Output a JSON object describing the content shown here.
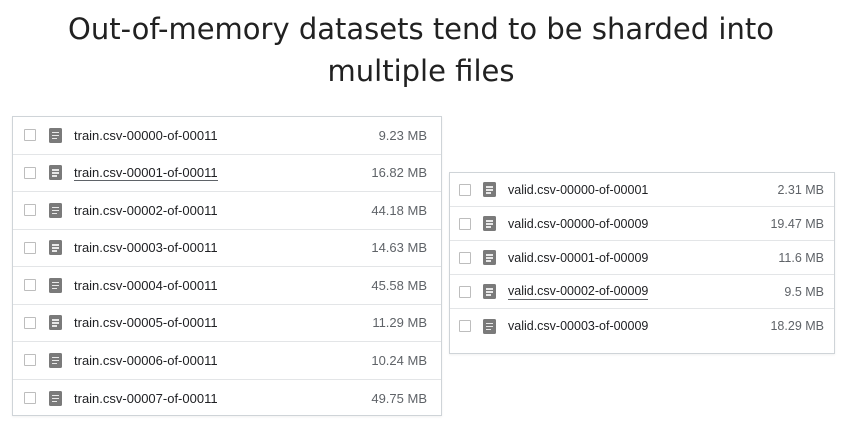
{
  "title": {
    "line1": "Out-of-memory datasets tend to be sharded into",
    "line2": "multiple files"
  },
  "train_files": [
    {
      "name": "train.csv-00000-of-00011",
      "size": "9.23 MB"
    },
    {
      "name": "train.csv-00001-of-00011",
      "size": "16.82 MB"
    },
    {
      "name": "train.csv-00002-of-00011",
      "size": "44.18 MB"
    },
    {
      "name": "train.csv-00003-of-00011",
      "size": "14.63 MB"
    },
    {
      "name": "train.csv-00004-of-00011",
      "size": "45.58 MB"
    },
    {
      "name": "train.csv-00005-of-00011",
      "size": "11.29 MB"
    },
    {
      "name": "train.csv-00006-of-00011",
      "size": "10.24 MB"
    },
    {
      "name": "train.csv-00007-of-00011",
      "size": "49.75 MB"
    }
  ],
  "valid_files": [
    {
      "name": "valid.csv-00000-of-00001",
      "size": "2.31 MB"
    },
    {
      "name": "valid.csv-00000-of-00009",
      "size": "19.47 MB"
    },
    {
      "name": "valid.csv-00001-of-00009",
      "size": "11.6 MB"
    },
    {
      "name": "valid.csv-00002-of-00009",
      "size": "9.5 MB"
    },
    {
      "name": "valid.csv-00003-of-00009",
      "size": "18.29 MB"
    }
  ],
  "colors": {
    "file_icon": "#7a7a7a",
    "border": "#cfd4d8",
    "text": "#202124",
    "size_text": "#5f6368"
  },
  "icons": {
    "file": "document-file-icon",
    "checkbox": "checkbox-unchecked"
  }
}
